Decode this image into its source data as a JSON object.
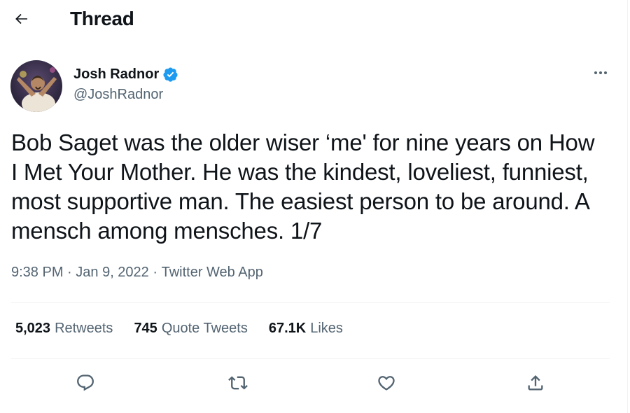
{
  "header": {
    "title": "Thread",
    "back_icon": "arrow-left-icon"
  },
  "tweet": {
    "author": {
      "display_name": "Josh Radnor",
      "handle": "@JoshRadnor",
      "verified": true,
      "avatar": "avatar-photo"
    },
    "text": "Bob Saget was the older wiser ‘me' for nine years on How I Met Your Mother. He was the kindest, loveliest, funniest, most supportive man. The easiest person to be around. A mensch among mensches. 1/7",
    "meta": {
      "time": "9:38 PM",
      "separator": " · ",
      "date": "Jan 9, 2022",
      "source": "Twitter Web App"
    },
    "stats": {
      "retweets_count": "5,023",
      "retweets_label": "Retweets",
      "quote_tweets_count": "745",
      "quote_tweets_label": "Quote Tweets",
      "likes_count": "67.1K",
      "likes_label": "Likes"
    },
    "actions": [
      "reply-icon",
      "retweet-icon",
      "like-icon",
      "share-icon"
    ]
  },
  "colors": {
    "primary_text": "#0f1419",
    "secondary_text": "#536471",
    "verified_blue": "#1d9bf0",
    "divider": "#eff3f4"
  }
}
